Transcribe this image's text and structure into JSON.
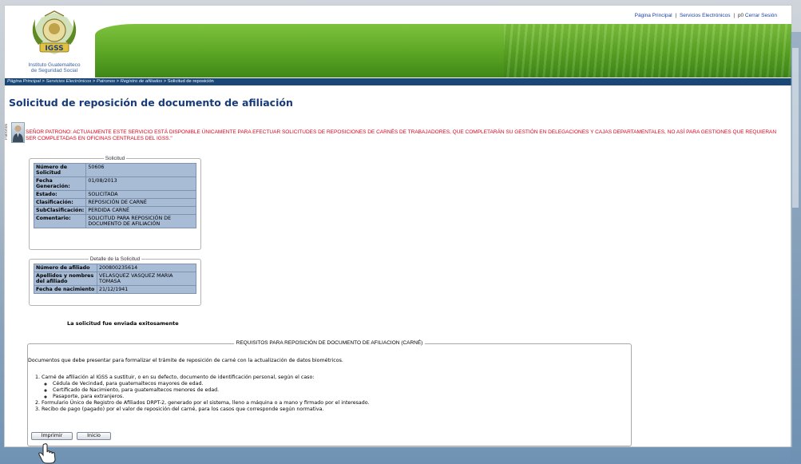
{
  "top_links": {
    "home": "Página Principal",
    "sep1": "|",
    "services": "Servicios Electrónicos",
    "sep2": "|",
    "user": "p0",
    "logout": "Cerrar Sesión"
  },
  "logo": {
    "badge": "IGSS",
    "line1": "Instituto Guatemalteco",
    "line2": "de Seguridad Social"
  },
  "breadcrumb": {
    "items": [
      "Página Principal",
      "Servicios Electrónicos",
      "Patronos",
      "Registro de afiliados"
    ],
    "sep": " > ",
    "current": "Solicitud de reposición"
  },
  "title": "Solicitud de reposición de documento de afiliación",
  "avatar_label": "Patronos",
  "notice": "SEÑOR PATRONO: ACTUALMENTE ESTE SERVICIO ESTÁ DISPONIBLE ÚNICAMENTE PARA EFECTUAR SOLICITUDES DE REPOSICIONES DE CARNÉS DE TRABAJADORES, QUE COMPLETARÁN SU GESTIÓN EN DELEGACIONES Y CAJAS DEPARTAMENTALES, NO ASÍ PARA GESTIONES QUE REQUIERAN SER COMPLETADAS EN OFICINAS CENTRALES DEL IGSS.\"",
  "solicitud": {
    "legend": "Solicitud",
    "rows": [
      {
        "k": "Número de Solicitud",
        "v": "50606"
      },
      {
        "k": "Fecha Generación:",
        "v": "01/08/2013"
      },
      {
        "k": "Estado:",
        "v": "SOLICITADA"
      },
      {
        "k": "Clasificación:",
        "v": "REPOSICIÓN DE CARNÉ"
      },
      {
        "k": "SubClasificación:",
        "v": "PERDIDA CARNÉ"
      },
      {
        "k": "Comentario:",
        "v": "SOLICITUD PARA REPOSICIÓN DE DOCUMENTO DE AFILIACIÓN"
      }
    ]
  },
  "detalle": {
    "legend": "Detalle de la Solicitud",
    "rows": [
      {
        "k": "Número de afiliado",
        "v": "200800235614"
      },
      {
        "k": "Apellidos y nombres del afiliado",
        "v": "VELASQUEZ VASQUEZ MARIA TOMASA"
      },
      {
        "k": "Fecha de nacimiento",
        "v": "21/12/1941"
      }
    ]
  },
  "success_msg": "La solicitud fue enviada exitosamente",
  "requisitos": {
    "title": "REQUISITOS PARA REPOSICIÓN DE DOCUMENTO DE AFILIACION (CARNÉ)",
    "intro": "Documentos que debe presentar para formalizar el trámite de reposición de carné con la actualización de datos biométricos.",
    "item1": "Carné de afiliación al IGSS a sustituir, o en su defecto, documento de identificación personal, según el caso:",
    "sub": [
      "Cédula de Vecindad, para guatemaltecos mayores de edad.",
      "Certificado de Nacimiento, para guatemaltecos menores de edad.",
      "Pasaporte, para extranjeros."
    ],
    "item2": "Formulario Único de Registro de Afiliados DRPT-2, generado por el sistema, lleno a máquina o a mano y firmado por el interesado.",
    "item3": "Recibo de pago (pagado) por el valor de reposición del carné, para los casos que corresponde según normativa."
  },
  "buttons": {
    "print": "Imprimir",
    "home": "Inicio"
  },
  "colors": {
    "breadcrumb_bg": "#1a4775",
    "title": "#163a7a",
    "notice": "#e0001a",
    "table_cell": "#a8bcd6",
    "banner_green": "#5aa524",
    "link": "#1a3fb0"
  }
}
